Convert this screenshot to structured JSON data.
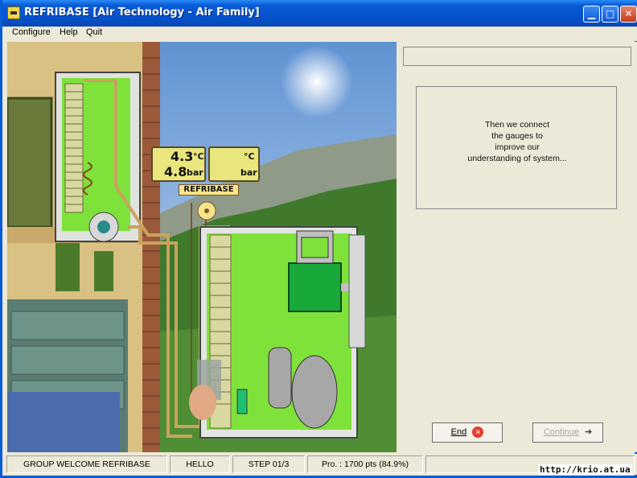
{
  "window": {
    "title": "REFRIBASE [Air Technology - Air Family]"
  },
  "menu": [
    "Configure",
    "Help",
    "Quit"
  ],
  "gauges": {
    "left": {
      "temp": "4.3",
      "temp_unit": "°C",
      "pressure": "4.8",
      "pressure_unit": "bar"
    },
    "right": {
      "temp": "",
      "temp_unit": "°C",
      "pressure": "",
      "pressure_unit": "bar"
    },
    "brand": "REFRIBASE"
  },
  "panel": {
    "top_field": "",
    "message": "Then we connect\nthe gauges to\nimprove our\nunderstanding of system...",
    "end_label": "End",
    "continue_label": "Continue"
  },
  "status": {
    "group": "GROUP WELCOME REFRIBASE",
    "user": "HELLO",
    "step": "STEP 01/3",
    "progress": "Pro. : 1700 pts (84.9%)"
  },
  "watermark": "http://krio.at.ua",
  "colors": {
    "titlebar": "#0a5bd6",
    "close_icon": "#e53c2c",
    "unit_green": "#7fe23a"
  },
  "icons": {
    "end": "close-circle-icon",
    "continue": "arrow-right-icon"
  }
}
